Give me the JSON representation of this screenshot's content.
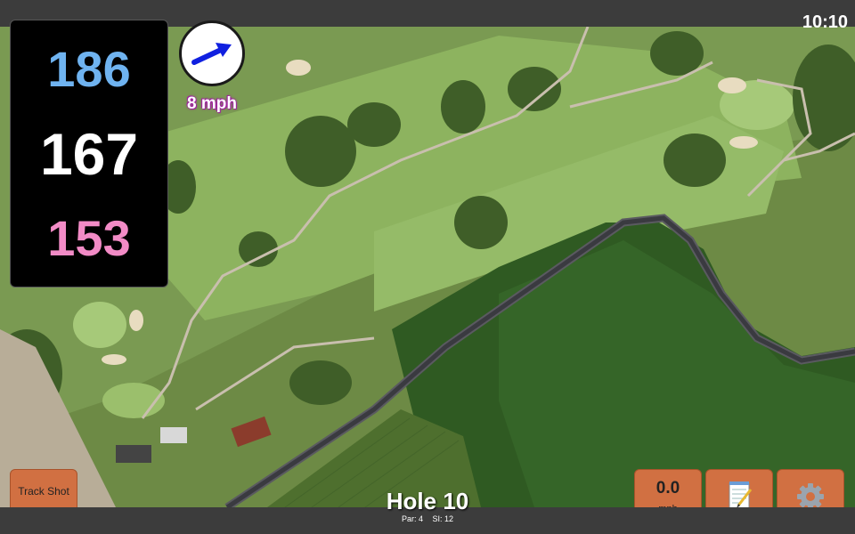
{
  "status": {
    "time": "10:10"
  },
  "yardage": {
    "back": "186",
    "center": "167",
    "front": "153"
  },
  "wind": {
    "speed": "8 mph",
    "icon": "wind-arrow-icon"
  },
  "buttons": {
    "track_shot": "Track Shot",
    "speed_value": "0.0",
    "speed_unit": "mph",
    "notes_icon": "notepad-icon",
    "settings_icon": "gear-icon"
  },
  "hole": {
    "title": "Hole 10",
    "par": "Par: 4",
    "si": "SI: 12"
  },
  "colors": {
    "back": "#6fb3f0",
    "center": "#ffffff",
    "front": "#f28bc6",
    "button": "#d17042",
    "wind_arrow": "#1020e0"
  }
}
